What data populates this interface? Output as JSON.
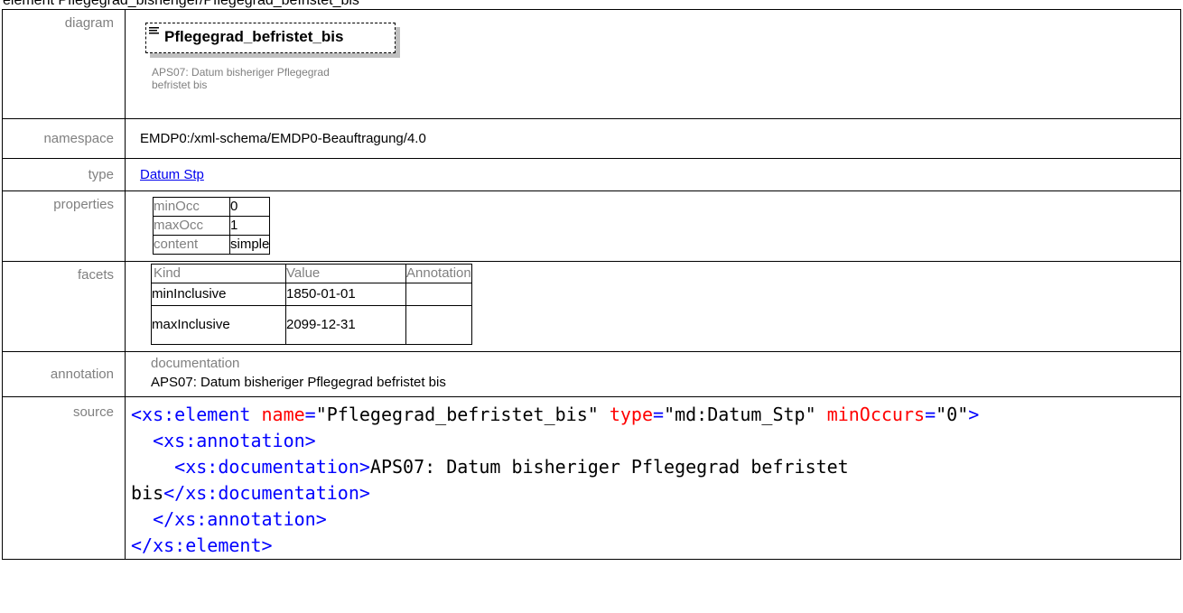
{
  "page_title": "element Pflegegrad_bisheriger/Pflegegrad_befristet_bis",
  "diagram": {
    "label": "diagram",
    "element_name": "Pflegegrad_befristet_bis",
    "annotation_text": "APS07: Datum bisheriger Pflegegrad befristet bis"
  },
  "namespace": {
    "label": "namespace",
    "value": "EMDP0:/xml-schema/EMDP0-Beauftragung/4.0"
  },
  "type": {
    "label": "type",
    "value": "Datum Stp"
  },
  "properties": {
    "label": "properties",
    "rows": [
      {
        "key": "minOcc",
        "value": "0"
      },
      {
        "key": "maxOcc",
        "value": "1"
      },
      {
        "key": "content",
        "value": "simple"
      }
    ]
  },
  "facets": {
    "label": "facets",
    "headers": [
      "Kind",
      "Value",
      "Annotation"
    ],
    "rows": [
      {
        "kind": "minInclusive",
        "value": "1850-01-01",
        "annotation": ""
      },
      {
        "kind": "maxInclusive",
        "value": "2099-12-31",
        "annotation": ""
      }
    ]
  },
  "annotation": {
    "label": "annotation",
    "header": "documentation",
    "value": "APS07: Datum bisheriger Pflegegrad befristet bis"
  },
  "source": {
    "label": "source",
    "el_open": "<xs:element",
    "attr_name": "name",
    "val_name": "\"Pflegegrad_befristet_bis\"",
    "attr_type": "type",
    "val_type": "\"md:Datum_Stp\"",
    "attr_min": "minOccurs",
    "val_min": "\"0\"",
    "close_gt": ">",
    "eq": "=",
    "ann_open": "<xs:annotation>",
    "doc_open": "<xs:documentation>",
    "doc_text_1": "APS07: Datum bisheriger Pflegegrad befristet",
    "doc_text_2": "bis",
    "doc_close": "</xs:documentation>",
    "ann_close": "</xs:annotation>",
    "el_close": "</xs:element>"
  }
}
